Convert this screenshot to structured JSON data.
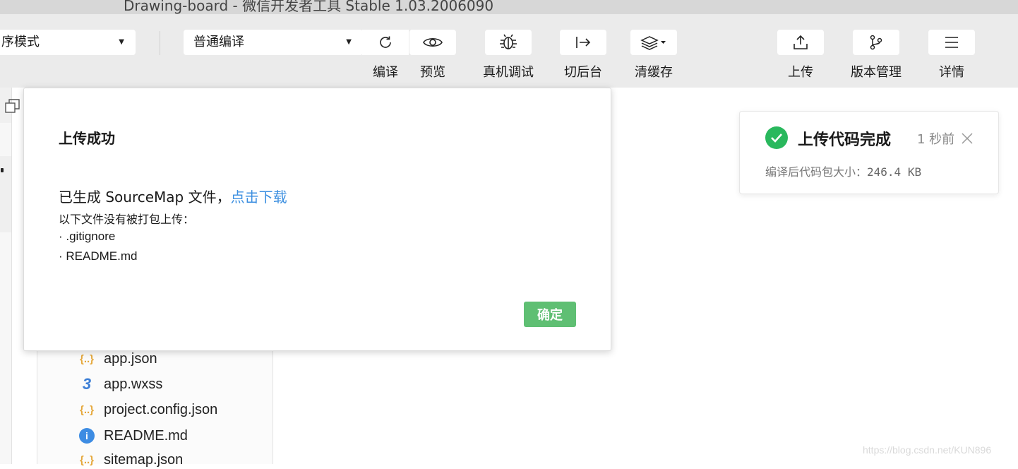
{
  "window": {
    "title": "Drawing-board - 微信开发者工具 Stable 1.03.2006090"
  },
  "toolbar": {
    "mode_select": "序模式",
    "compile_select": "普通编译",
    "buttons": [
      {
        "label": "编译",
        "icon": "refresh-icon"
      },
      {
        "label": "预览",
        "icon": "eye-icon"
      },
      {
        "label": "真机调试",
        "icon": "bug-icon"
      },
      {
        "label": "切后台",
        "icon": "switch-background-icon"
      },
      {
        "label": "清缓存",
        "icon": "layers-icon"
      },
      {
        "label": "上传",
        "icon": "upload-icon"
      },
      {
        "label": "版本管理",
        "icon": "branch-icon"
      },
      {
        "label": "详情",
        "icon": "menu-icon"
      }
    ]
  },
  "files": [
    {
      "name": "app.json",
      "icon": "json-icon",
      "icon_glyph": "{..}"
    },
    {
      "name": "app.wxss",
      "icon": "css-icon",
      "icon_glyph": "3"
    },
    {
      "name": "project.config.json",
      "icon": "json-icon",
      "icon_glyph": "{..}"
    },
    {
      "name": "README.md",
      "icon": "info-icon",
      "icon_glyph": "i"
    },
    {
      "name": "sitemap.json",
      "icon": "json-icon",
      "icon_glyph": "{..}"
    }
  ],
  "dialog": {
    "title": "上传成功",
    "sourcemap_text": "已生成 SourceMap 文件，",
    "download_link": "点击下载",
    "not_uploaded_text": "以下文件没有被打包上传：",
    "not_uploaded_files": [
      "· .gitignore",
      "· README.md"
    ],
    "confirm_label": "确定"
  },
  "toast": {
    "title": "上传代码完成",
    "time": "1 秒前",
    "size_label": "编译后代码包大小：",
    "size_value": "246.4 KB"
  },
  "watermark": "https://blog.csdn.net/KUN896",
  "colors": {
    "accent_green": "#29b85d",
    "button_green": "#5fbf73",
    "link_blue": "#3c8fe0",
    "toolbar_bg": "#ebebeb"
  }
}
